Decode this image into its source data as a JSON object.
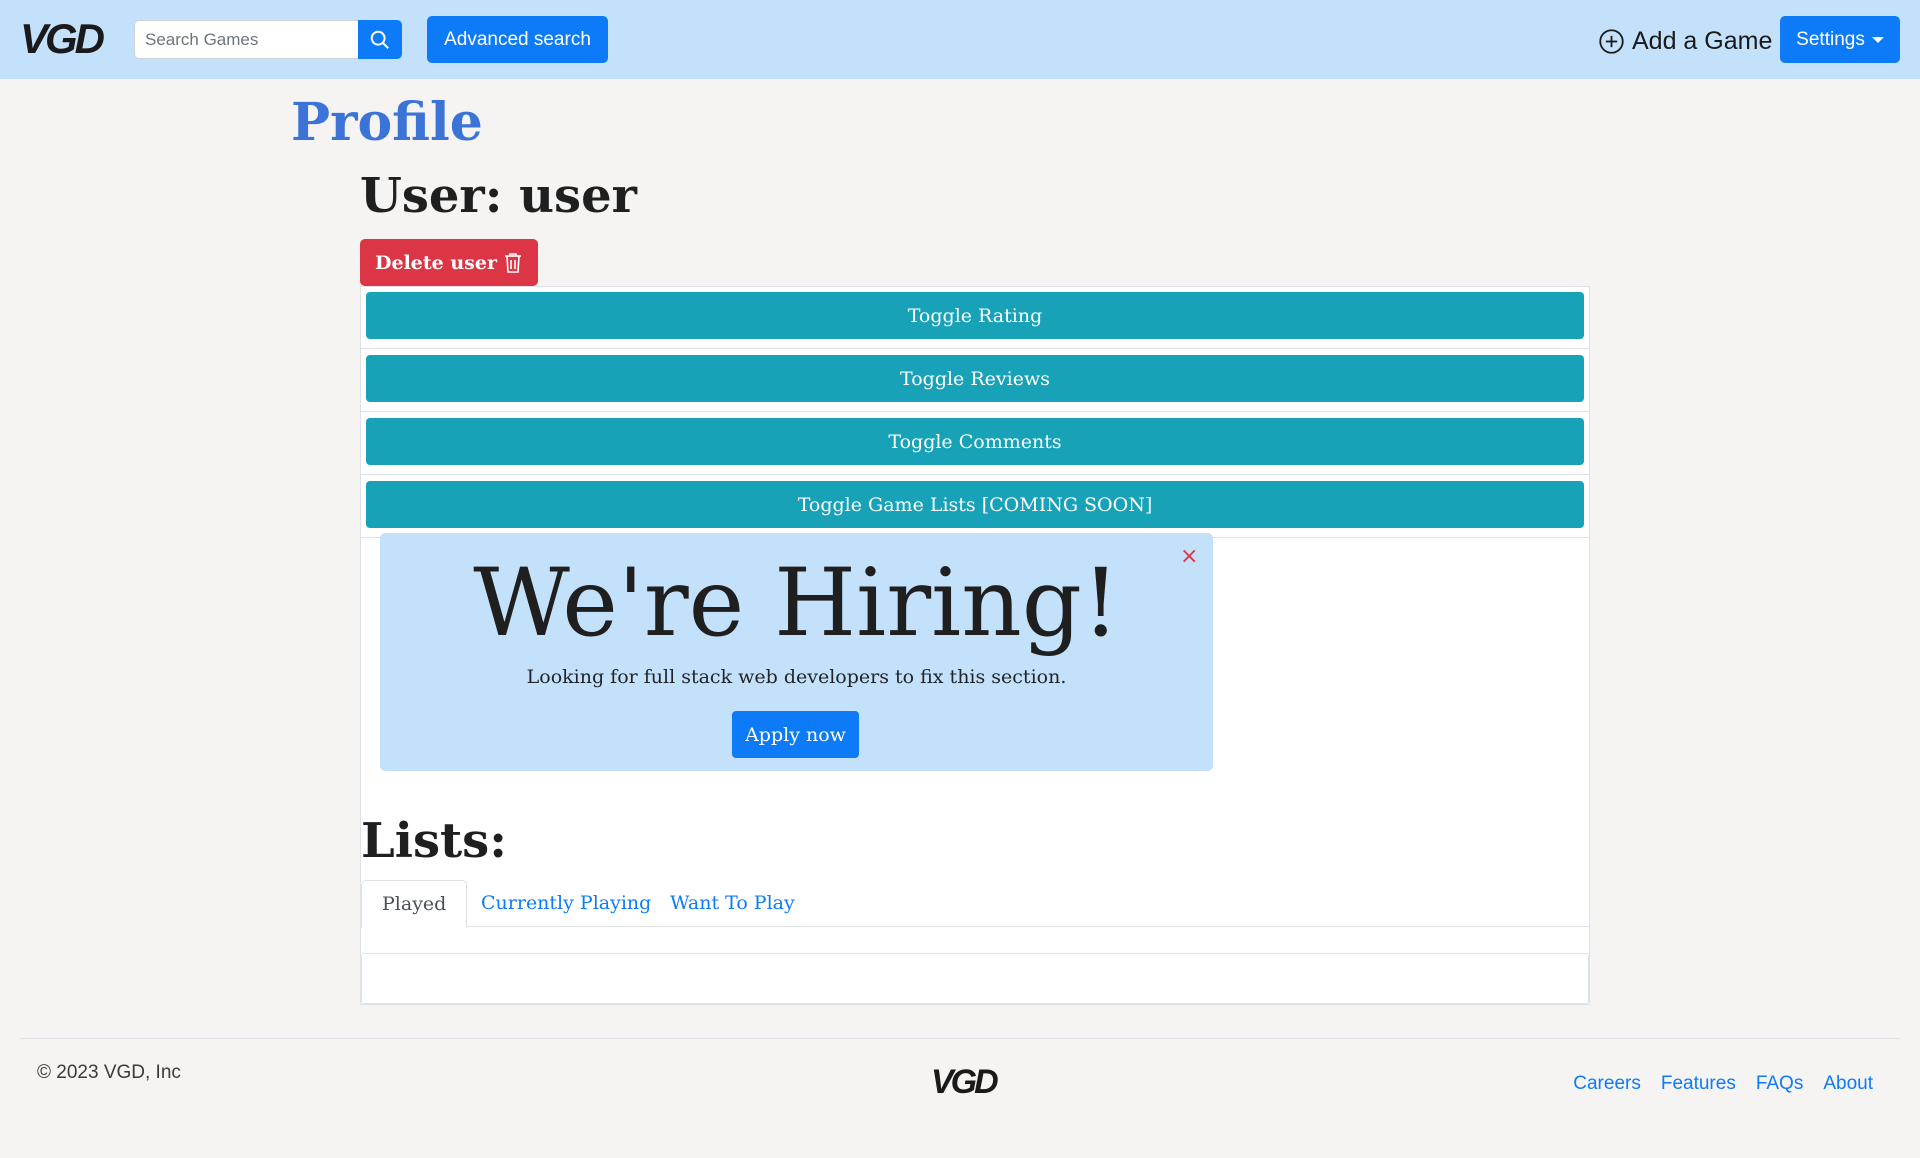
{
  "navbar": {
    "logo": "VGD",
    "search_placeholder": "Search Games",
    "advanced_search_label": "Advanced search",
    "add_game_label": "Add a Game",
    "settings_label": "Settings"
  },
  "page": {
    "title": "Profile",
    "user_heading": "User: user",
    "delete_user_label": "Delete user"
  },
  "toggles": [
    "Toggle Rating",
    "Toggle Reviews",
    "Toggle Comments",
    "Toggle Game Lists [COMING SOON]"
  ],
  "hiring": {
    "heading": "We're Hiring!",
    "text": "Looking for full stack web developers to fix this section.",
    "apply_label": "Apply now",
    "close_glyph": "×"
  },
  "lists": {
    "heading": "Lists:",
    "tabs": [
      "Played",
      "Currently Playing",
      "Want To Play"
    ],
    "active_tab": "Played"
  },
  "footer": {
    "copyright": "© 2023 VGD, Inc",
    "logo": "VGD",
    "links": [
      "Careers",
      "Features",
      "FAQs",
      "About"
    ]
  },
  "colors": {
    "navbar_bg": "#c4e1fc",
    "primary": "#0d7bf7",
    "danger": "#dc3545",
    "info": "#17a2b8",
    "title": "#3b73d6"
  },
  "icons": [
    "search-icon",
    "plus-circle-icon",
    "trash-icon",
    "close-icon",
    "chevron-down-icon"
  ]
}
